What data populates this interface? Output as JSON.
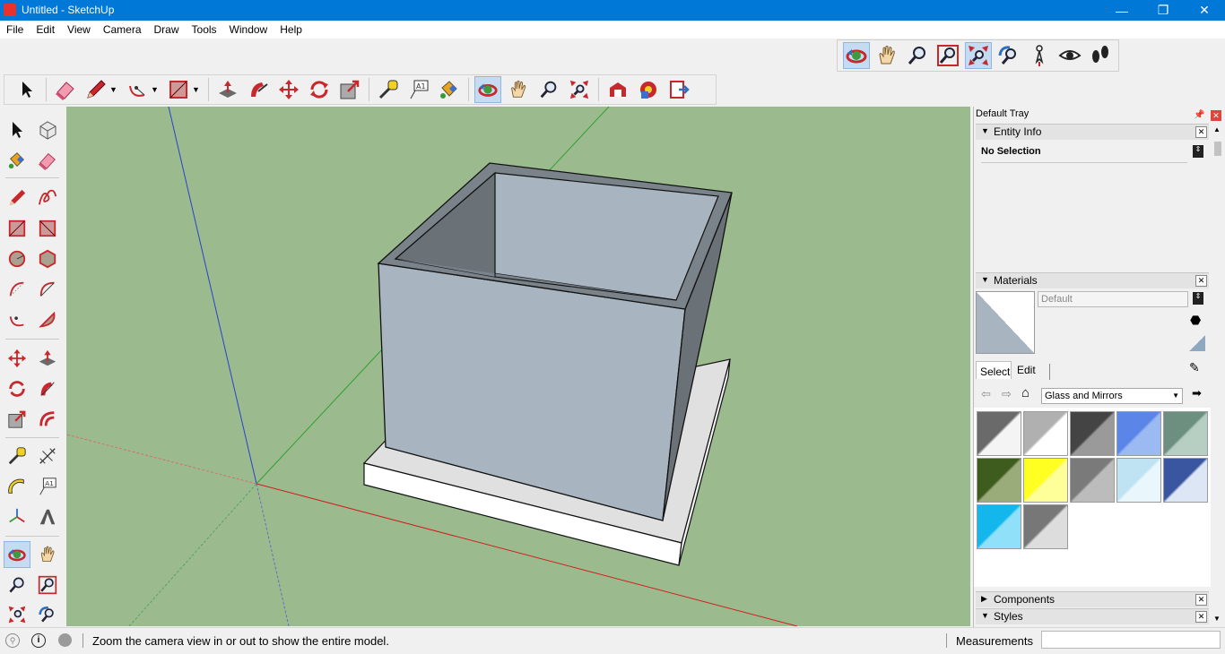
{
  "window": {
    "title": "Untitled - SketchUp",
    "minimize": "—",
    "maximize": "❐",
    "close": "✕"
  },
  "menu": [
    "File",
    "Edit",
    "View",
    "Camera",
    "Draw",
    "Tools",
    "Window",
    "Help"
  ],
  "toolbar_top": [
    "orbit-icon",
    "pan-icon",
    "zoom-icon",
    "zoom-window-icon",
    "zoom-extents-icon",
    "previous-view-icon",
    "position-camera-icon",
    "look-around-icon",
    "walk-icon"
  ],
  "tray": {
    "title": "Default Tray",
    "entity_info": {
      "label": "Entity Info",
      "selection": "No Selection"
    },
    "materials": {
      "label": "Materials",
      "name_value": "Default",
      "tabs": {
        "select": "Select",
        "edit": "Edit"
      },
      "library": "Glass and Mirrors",
      "swatches": [
        {
          "c1": "#6a6a6a",
          "c2": "#f4f4f4"
        },
        {
          "c1": "#b0b0b0",
          "c2": "#ffffff"
        },
        {
          "c1": "#444444",
          "c2": "#9a9a9a"
        },
        {
          "c1": "#5b86e8",
          "c2": "#9cbaf2"
        },
        {
          "c1": "#6c8f80",
          "c2": "#b7cfc2"
        },
        {
          "c1": "#3d5c1e",
          "c2": "#9aac7a"
        },
        {
          "c1": "#ffff22",
          "c2": "#ffff9a"
        },
        {
          "c1": "#7a7a7a",
          "c2": "#bcbcbc"
        },
        {
          "c1": "#bfe3f3",
          "c2": "#e9f6fb"
        },
        {
          "c1": "#3a56a0",
          "c2": "#dde6f5"
        },
        {
          "c1": "#14b7ec",
          "c2": "#8fe0f8"
        },
        {
          "c1": "#777777",
          "c2": "#dddddd"
        }
      ]
    },
    "components": {
      "label": "Components"
    },
    "styles": {
      "label": "Styles"
    }
  },
  "status": {
    "message": "Zoom the camera view in or out to show the entire model.",
    "measurements_label": "Measurements",
    "measurements_value": ""
  },
  "colors": {
    "viewport_bg": "#9bbb8e",
    "accent": "#0078d7",
    "active_tool_bg": "#c5dbf2"
  }
}
